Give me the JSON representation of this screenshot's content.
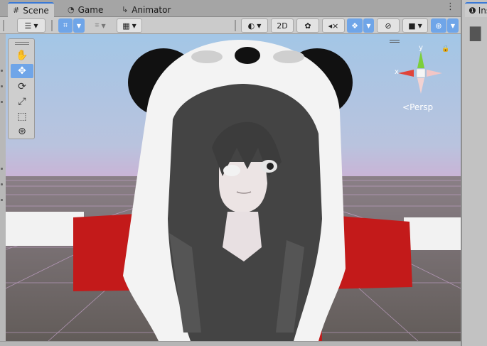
{
  "tabs": [
    {
      "label": "Scene",
      "icon": "scene-grid-icon"
    },
    {
      "label": "Game",
      "icon": "gamepad-icon"
    },
    {
      "label": "Animator",
      "icon": "animator-icon"
    }
  ],
  "tab_menu": "⋮",
  "toolbar": {
    "mode_2d": "2D"
  },
  "palette_tools": [
    "hand-tool",
    "move-tool",
    "rotate-tool",
    "scale-tool",
    "rect-tool",
    "transform-tool"
  ],
  "gizmo": {
    "y_axis": "y",
    "x_axis": "x",
    "projection": "Persp"
  },
  "side_panel": {
    "tab_label": "Ins"
  },
  "colors": {
    "accent": "#3a79d6",
    "active_button": "#6fa5e8",
    "sky_top": "#9ec2e3",
    "horizon": "#b8a9cf",
    "floor": "#6a6360",
    "shirt_red": "#c31a1a",
    "hair": "#454545",
    "hood_white": "#f3f3f3",
    "ear_black": "#111111"
  }
}
